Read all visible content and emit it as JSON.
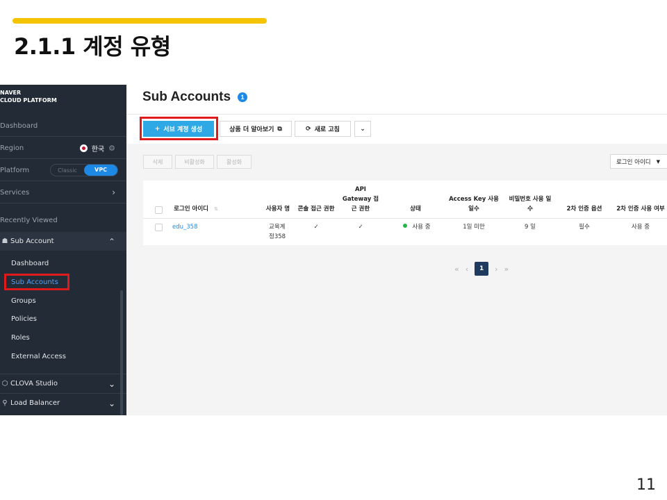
{
  "slide": {
    "title": "2.1.1 계정 유형",
    "page_number": "11",
    "accent_color": "#f5c400"
  },
  "sidebar": {
    "brand_line1": "NAVER",
    "brand_line2": "CLOUD PLATFORM",
    "dashboard": "Dashboard",
    "region_label": "Region",
    "region_value": "한국",
    "platform_label": "Platform",
    "platform_options": [
      "Classic",
      "VPC"
    ],
    "services_label": "Services",
    "recently_viewed": "Recently Viewed",
    "section_sub_account": "Sub Account",
    "sub_items": [
      "Dashboard",
      "Sub Accounts",
      "Groups",
      "Policies",
      "Roles",
      "External Access"
    ],
    "bottom_items": [
      "CLOVA Studio",
      "Load Balancer"
    ]
  },
  "main": {
    "title": "Sub Accounts",
    "count": "1",
    "create_button": "서브 계정 생성",
    "learn_more_button": "상품 더 알아보기",
    "refresh_button": "새로 고침",
    "action_buttons": [
      "삭제",
      "비활성화",
      "활성화"
    ],
    "filter_select": "로그인 아이디",
    "table": {
      "headers": [
        "로그인 아이디",
        "사용자 명",
        "콘솔 접근 권한",
        "API Gateway 접근 권한",
        "상태",
        "Access Key 사용 일수",
        "비밀번호 사용 일수",
        "2차 인증 옵션",
        "2차 인증 사용 여부"
      ],
      "row": {
        "login_id": "edu_358",
        "user_name": "교육계정358",
        "console_access": "✓",
        "api_gateway_access": "✓",
        "status": "사용 중",
        "access_key_days": "1일 미만",
        "password_days": "9 일",
        "mfa_option": "필수",
        "mfa_usage": "사용 중"
      }
    },
    "pagination": {
      "current": "1"
    }
  }
}
